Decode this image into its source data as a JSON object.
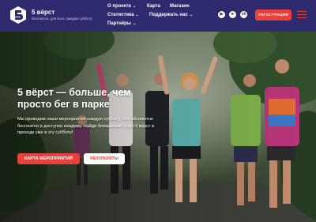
{
  "header": {
    "brand_name": "5 вёрст",
    "tagline": "бесплатно, для всех, каждую субботу",
    "nav": [
      {
        "label": "О проекте",
        "has_dropdown": true
      },
      {
        "label": "Карта",
        "has_dropdown": false
      },
      {
        "label": "Магазин",
        "has_dropdown": false
      },
      {
        "label": "Статистика",
        "has_dropdown": true
      },
      {
        "label": "Поддержать нас",
        "has_dropdown": true
      },
      {
        "label": "Партнёры",
        "has_dropdown": true
      }
    ],
    "social_icons": [
      "youtube-icon",
      "telegram-icon",
      "vk-icon"
    ],
    "register_label": "РЕГИСТРАЦИЯ",
    "colors": {
      "header_bg": "#2d2a6e",
      "accent": "#e8413b"
    }
  },
  "hero": {
    "title": "5 вёрст — больше, чем просто бег в парке",
    "description": "Мы проводим наши мероприятия каждую субботу. Это абсолютно бесплатно и доступно каждому. Найди ближайший старт 5 вёрст и приходи уже в эту субботу!",
    "map_button_label": "КАРТА МЕРОПРИЯТИЙ",
    "results_button_label": "РЕЗУЛЬТАТЫ"
  }
}
